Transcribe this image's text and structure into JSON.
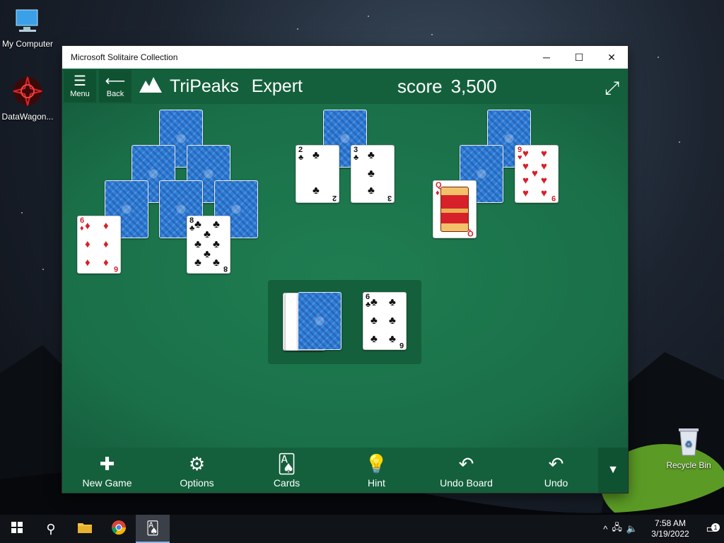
{
  "desktop": {
    "icons": [
      {
        "label": "My Computer",
        "icon": "computer-icon"
      },
      {
        "label": "DataWagon...",
        "icon": "datawagon-icon"
      },
      {
        "label": "Recycle Bin",
        "icon": "recycle-bin-icon"
      }
    ]
  },
  "window": {
    "title": "Microsoft Solitaire Collection",
    "controls": {
      "minimize": "─",
      "maximize": "☐",
      "close": "✕"
    }
  },
  "header": {
    "menu_label": "Menu",
    "back_label": "Back",
    "game_name": "TriPeaks",
    "mode": "Expert",
    "score_label": "score",
    "score_value": "3,500"
  },
  "cards": {
    "peak1_faceup": [
      {
        "rank": "6",
        "suit": "♦",
        "color": "red"
      },
      {
        "rank": "8",
        "suit": "♣",
        "color": "black"
      }
    ],
    "peak2_faceup": [
      {
        "rank": "2",
        "suit": "♣",
        "color": "black"
      },
      {
        "rank": "3",
        "suit": "♣",
        "color": "black"
      }
    ],
    "peak3_faceup": [
      {
        "rank": "Q",
        "suit": "♦",
        "color": "red"
      },
      {
        "rank": "9",
        "suit": "♥",
        "color": "red"
      }
    ],
    "waste": {
      "rank": "6",
      "suit": "♣",
      "color": "black"
    }
  },
  "toolbar": {
    "items": [
      {
        "label": "New Game",
        "icon": "plus-icon"
      },
      {
        "label": "Options",
        "icon": "gear-icon"
      },
      {
        "label": "Cards",
        "icon": "cards-icon"
      },
      {
        "label": "Hint",
        "icon": "lightbulb-icon"
      },
      {
        "label": "Undo Board",
        "icon": "undo-board-icon"
      },
      {
        "label": "Undo",
        "icon": "undo-icon"
      }
    ]
  },
  "taskbar": {
    "time": "7:58 AM",
    "date": "3/19/2022",
    "notification_count": "1"
  },
  "colors": {
    "felt": "#1b7a4d",
    "header": "#14603c",
    "card_back": "#2f7fd8",
    "red_suit": "#d8202a"
  }
}
